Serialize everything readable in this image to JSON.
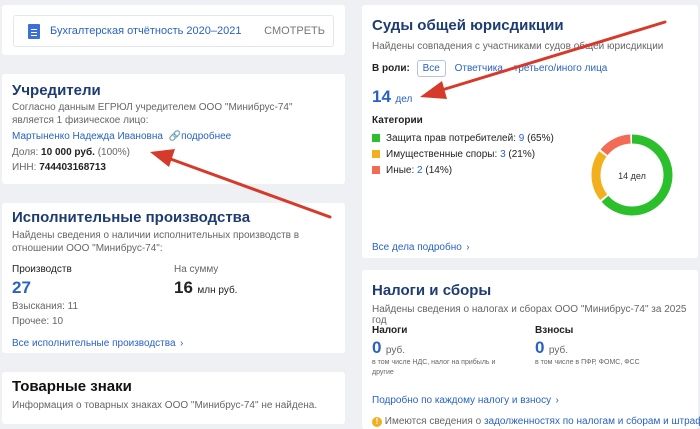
{
  "report": {
    "title": "Бухгалтерская отчётность 2020–2021",
    "action": "СМОТРЕТЬ"
  },
  "founders": {
    "title": "Учредители",
    "desc": "Согласно данным ЕГРЮЛ учредителем ООО \"Минибрус-74\" является 1 физическое лицо:",
    "person": "Мартыненко Надежда Ивановна",
    "more": "подробнее",
    "share_label": "Доля:",
    "share_value": "10 000 руб.",
    "share_pct": "(100%)",
    "inn_label": "ИНН:",
    "inn_value": "744403168713"
  },
  "enforcement": {
    "title": "Исполнительные производства",
    "desc": "Найдены сведения о наличии исполнительных производств в отношении ООО \"Минибрус-74\":",
    "count_label": "Производств",
    "count_value": "27",
    "sum_label": "На сумму",
    "sum_value": "16",
    "sum_unit": "млн руб.",
    "recovery": "Взыскания: 11",
    "other": "Прочее: 10",
    "all_link": "Все исполнительные производства"
  },
  "trademarks": {
    "title": "Товарные знаки",
    "desc": "Информация о товарных знаках ООО \"Минибрус-74\" не найдена."
  },
  "courts": {
    "title": "Суды общей юрисдикции",
    "desc": "Найдены совпадения с участниками судов общей юрисдикции",
    "role_label": "В роли:",
    "role_all": "Все",
    "role_defendant": "Ответчика",
    "role_third": "третьего/иного лица",
    "cases_value": "14",
    "cases_unit": "дел",
    "cat_label": "Категории",
    "categories": [
      {
        "name": "Защита прав потребителей:",
        "count": "9",
        "pct": "(65%)",
        "color": "#2bbf2b"
      },
      {
        "name": "Имущественные споры:",
        "count": "3",
        "pct": "(21%)",
        "color": "#f2b01e"
      },
      {
        "name": "Иные:",
        "count": "2",
        "pct": "(14%)",
        "color": "#f26b55"
      }
    ],
    "donut_label": "14 дел",
    "all_link": "Все дела подробно"
  },
  "taxes": {
    "title": "Налоги и сборы",
    "desc": "Найдены сведения о налогах и сборах ООО \"Минибрус-74\" за 2025 год",
    "tax_label": "Налоги",
    "tax_value": "0",
    "tax_unit": "руб.",
    "tax_note": "в том числе НДС, налог на прибыль и другие",
    "fee_label": "Взносы",
    "fee_value": "0",
    "fee_unit": "руб.",
    "fee_note": "в том числе в ПФР, ФОМС, ФСС",
    "each_link": "Подробно по каждому налогу и взносу",
    "debt_prefix": "Имеются сведения о",
    "debt_link": "задолженностях по налогам и сборам и штрафах"
  },
  "chart_data": {
    "type": "pie",
    "categories": [
      "Защита прав потребителей",
      "Имущественные споры",
      "Иные"
    ],
    "values": [
      9,
      3,
      2
    ],
    "colors": [
      "#2bbf2b",
      "#f2b01e",
      "#f26b55"
    ]
  }
}
